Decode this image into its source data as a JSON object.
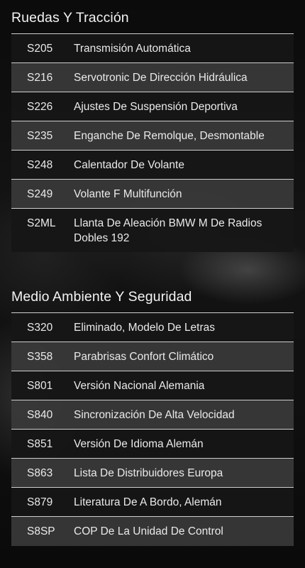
{
  "sections": [
    {
      "title": "Ruedas Y Tracción",
      "items": [
        {
          "code": "S205",
          "desc": "Transmisión Automática"
        },
        {
          "code": "S216",
          "desc": "Servotronic De Dirección Hidráulica"
        },
        {
          "code": "S226",
          "desc": "Ajustes De Suspensión Deportiva"
        },
        {
          "code": "S235",
          "desc": "Enganche De Remolque, Desmontable"
        },
        {
          "code": "S248",
          "desc": "Calentador De Volante"
        },
        {
          "code": "S249",
          "desc": "Volante F Multifunción"
        },
        {
          "code": "S2ML",
          "desc": "Llanta De Aleación BMW M De Radios Dobles 192"
        }
      ]
    },
    {
      "title": "Medio Ambiente Y Seguridad",
      "items": [
        {
          "code": "S320",
          "desc": "Eliminado, Modelo De Letras"
        },
        {
          "code": "S358",
          "desc": "Parabrisas Confort Climático"
        },
        {
          "code": "S801",
          "desc": "Versión Nacional Alemania"
        },
        {
          "code": "S840",
          "desc": "Sincronización De Alta Velocidad"
        },
        {
          "code": "S851",
          "desc": "Versión De Idioma Alemán"
        },
        {
          "code": "S863",
          "desc": "Lista De Distribuidores Europa"
        },
        {
          "code": "S879",
          "desc": "Literatura De A Bordo, Alemán"
        },
        {
          "code": "S8SP",
          "desc": "COP De La Unidad De Control"
        }
      ]
    }
  ]
}
